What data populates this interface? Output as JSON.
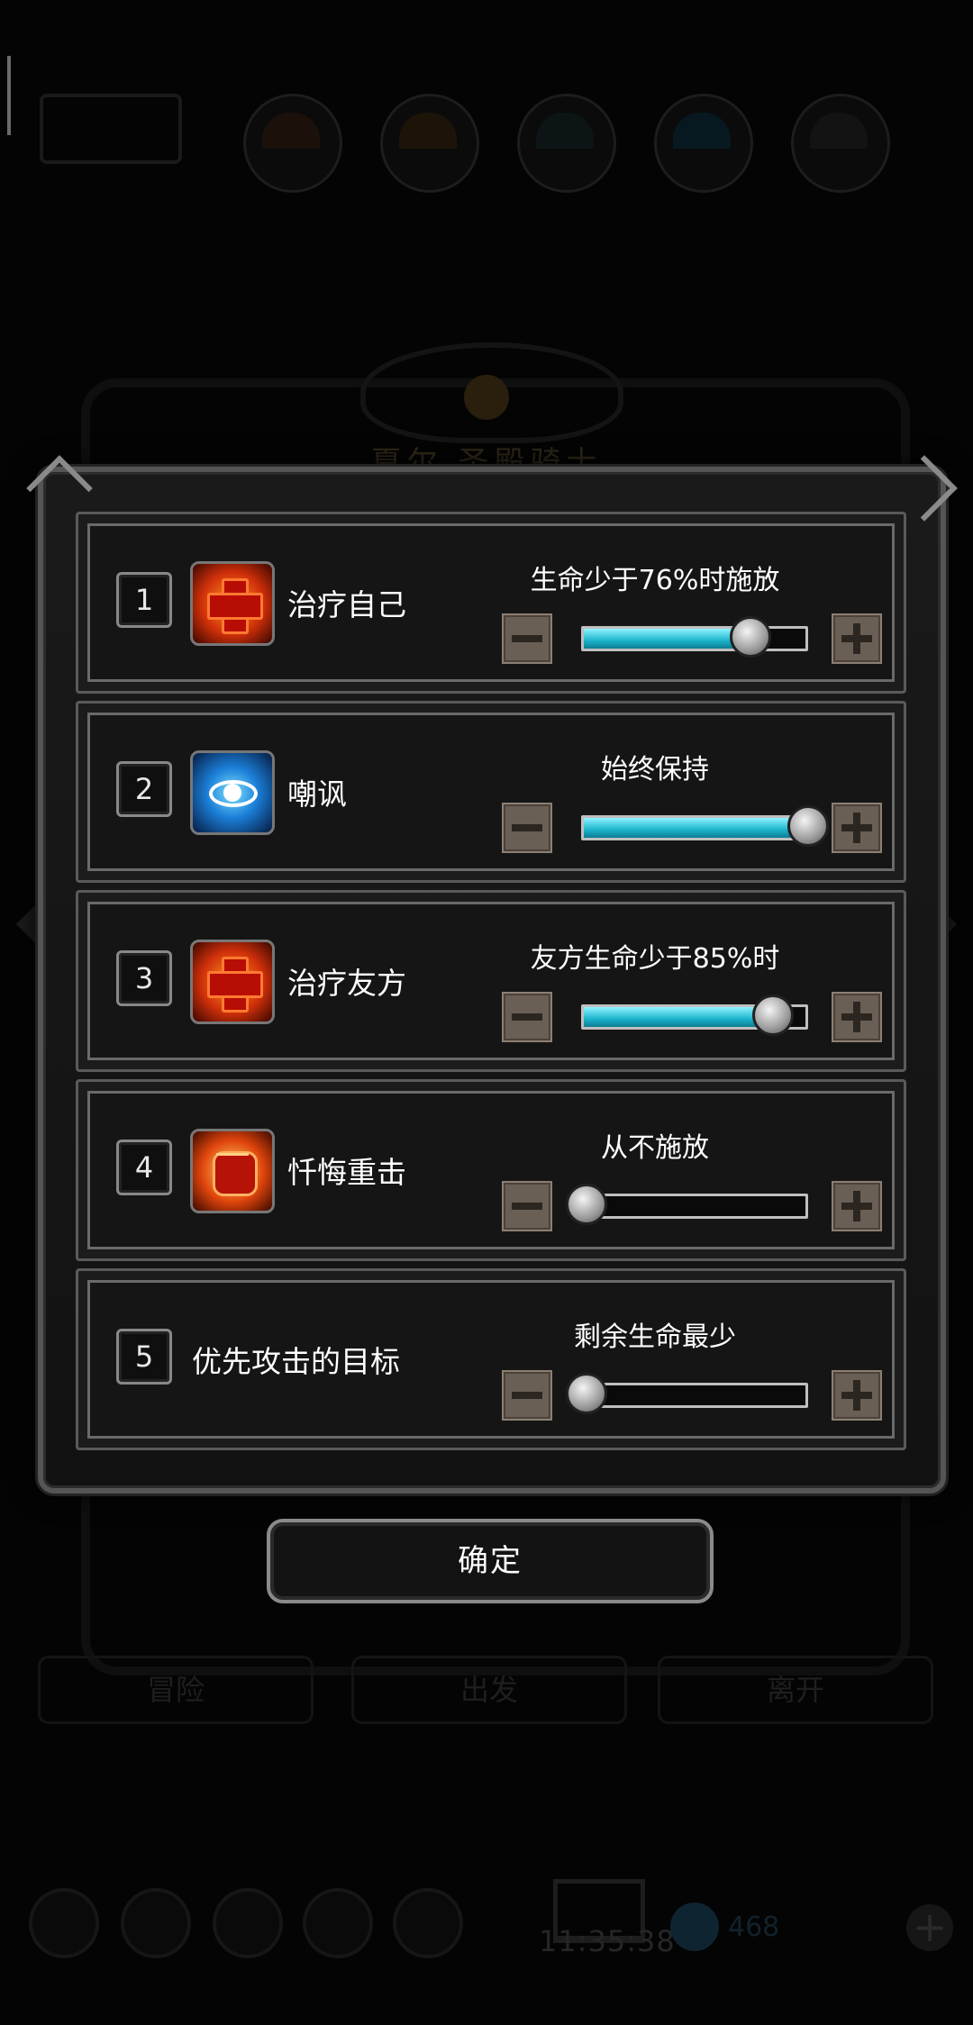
{
  "background": {
    "title": "夏尔 圣殿骑士",
    "bottom_buttons": [
      "冒险",
      "出发",
      "离开"
    ],
    "time": "11:35:38",
    "gem_count": "468"
  },
  "rows": [
    {
      "number": "1",
      "icon": "heal-cross-icon",
      "name": "治疗自己",
      "condition": "生命少于76%时施放",
      "slider_fraction": 0.74
    },
    {
      "number": "2",
      "icon": "taunt-eye-icon",
      "name": "嘲讽",
      "condition": "始终保持",
      "slider_fraction": 1.0
    },
    {
      "number": "3",
      "icon": "heal-cross-icon",
      "name": "治疗友方",
      "condition": "友方生命少于85%时",
      "slider_fraction": 0.84
    },
    {
      "number": "4",
      "icon": "fist-icon",
      "name": "忏悔重击",
      "condition": "从不施放",
      "slider_fraction": 0.0
    },
    {
      "number": "5",
      "icon": null,
      "name": "优先攻击的目标",
      "condition": "剩余生命最少",
      "slider_fraction": 0.0
    }
  ],
  "confirm_label": "确定",
  "colors": {
    "slider_fill": "#1cb4cc",
    "step_button": "#6a5f55",
    "dialog_border": "#555555"
  }
}
